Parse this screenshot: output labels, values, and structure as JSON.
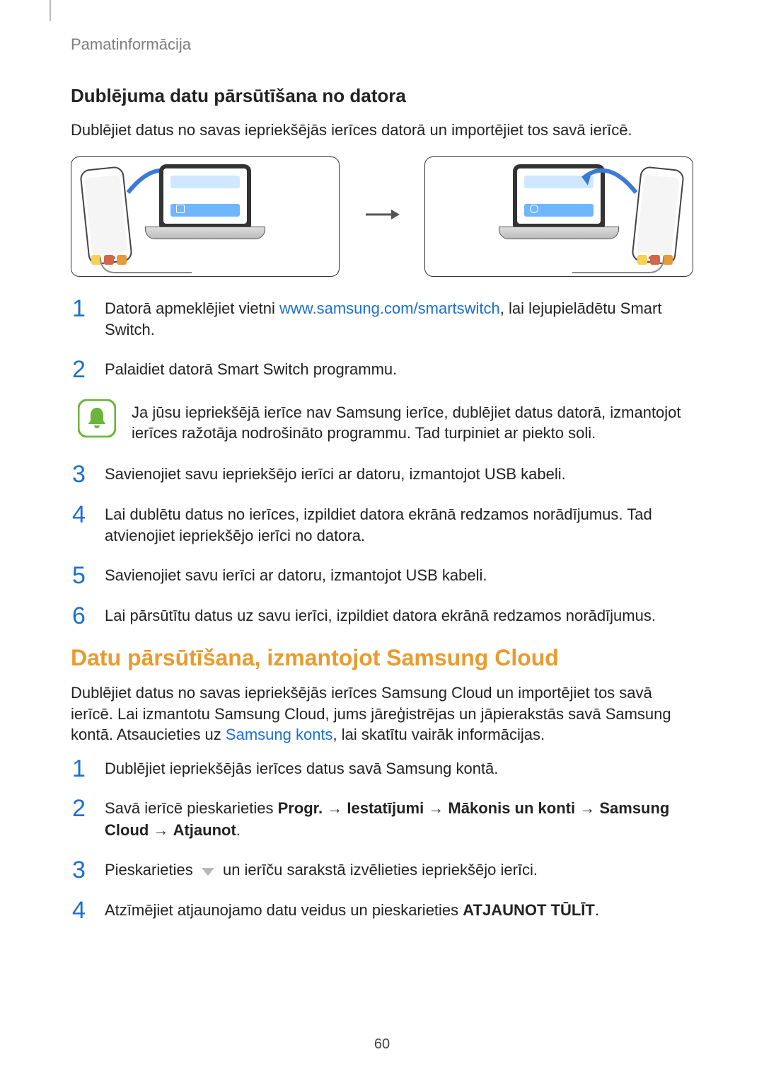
{
  "header": {
    "breadcrumb": "Pamatinformācija"
  },
  "section1": {
    "title": "Dublējuma datu pārsūtīšana no datora",
    "intro": "Dublējiet datus no savas iepriekšējās ierīces datorā un importējiet tos savā ierīcē.",
    "steps": {
      "s1_pre": "Datorā apmeklējiet vietni ",
      "s1_link": "www.samsung.com/smartswitch",
      "s1_post": ", lai lejupielādētu Smart Switch.",
      "s2": "Palaidiet datorā Smart Switch programmu.",
      "note": "Ja jūsu iepriekšējā ierīce nav Samsung ierīce, dublējiet datus datorā, izmantojot ierīces ražotāja nodrošināto programmu. Tad turpiniet ar piekto soli.",
      "s3": "Savienojiet savu iepriekšējo ierīci ar datoru, izmantojot USB kabeli.",
      "s4": "Lai dublētu datus no ierīces, izpildiet datora ekrānā redzamos norādījumus. Tad atvienojiet iepriekšējo ierīci no datora.",
      "s5": "Savienojiet savu ierīci ar datoru, izmantojot USB kabeli.",
      "s6": "Lai pārsūtītu datus uz savu ierīci, izpildiet datora ekrānā redzamos norādījumus."
    },
    "nums": {
      "n1": "1",
      "n2": "2",
      "n3": "3",
      "n4": "4",
      "n5": "5",
      "n6": "6"
    }
  },
  "section2": {
    "title": "Datu pārsūtīšana, izmantojot Samsung Cloud",
    "intro_pre": "Dublējiet datus no savas iepriekšējās ierīces Samsung Cloud un importējiet tos savā ierīcē. Lai izmantotu Samsung Cloud, jums jāreģistrējas un jāpierakstās savā Samsung kontā. Atsaucieties uz ",
    "intro_link": "Samsung konts",
    "intro_post": ", lai skatītu vairāk informācijas.",
    "steps": {
      "s1": "Dublējiet iepriekšējās ierīces datus savā Samsung kontā.",
      "s2_pre": "Savā ierīcē pieskarieties ",
      "s2_b1": "Progr.",
      "s2_arr": " → ",
      "s2_b2": "Iestatījumi",
      "s2_b3": "Mākonis un konti",
      "s2_b4": "Samsung Cloud",
      "s2_b5": "Atjaunot",
      "s2_dot": ".",
      "s3_pre": "Pieskarieties ",
      "s3_post": " un ierīču sarakstā izvēlieties iepriekšējo ierīci.",
      "s4_pre": "Atzīmējiet atjaunojamo datu veidus un pieskarieties ",
      "s4_b": "ATJAUNOT TŪLĪT",
      "s4_post": "."
    },
    "nums": {
      "n1": "1",
      "n2": "2",
      "n3": "3",
      "n4": "4"
    }
  },
  "page_number": "60"
}
